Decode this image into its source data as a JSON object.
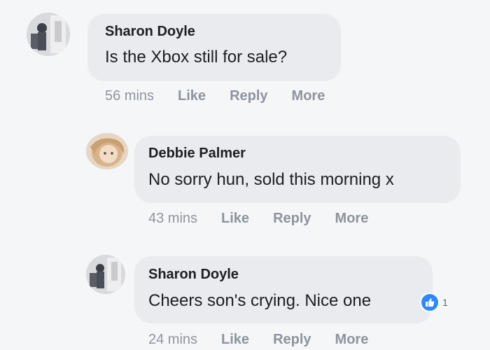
{
  "comments": [
    {
      "author": "Sharon Doyle",
      "text": "Is the Xbox still for sale?",
      "time": "56 mins",
      "actions": [
        "Like",
        "Reply",
        "More"
      ]
    },
    {
      "author": "Debbie Palmer",
      "text": "No sorry hun, sold this morning x",
      "time": "43 mins",
      "actions": [
        "Like",
        "Reply",
        "More"
      ]
    },
    {
      "author": "Sharon Doyle",
      "text": "Cheers son's crying. Nice one",
      "time": "24 mins",
      "actions": [
        "Like",
        "Reply",
        "More"
      ],
      "reaction": {
        "icon": "thumbs-up-icon",
        "count": "1",
        "color": "#2d88ff"
      }
    }
  ]
}
